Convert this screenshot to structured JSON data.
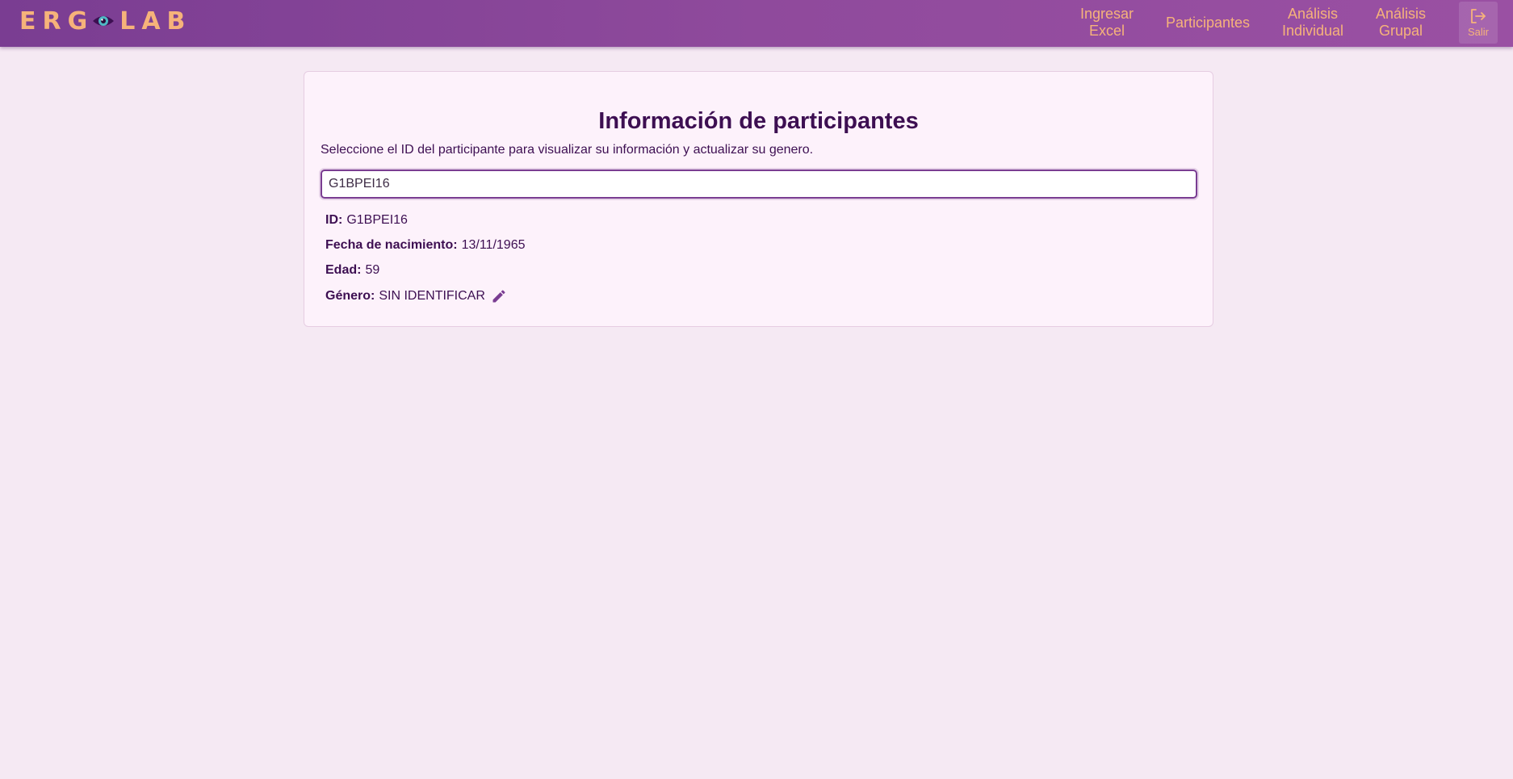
{
  "header": {
    "logo_left": "ERG",
    "logo_right": "LAB",
    "logo_icon": "eye-icon",
    "nav": [
      {
        "line1": "Ingresar",
        "line2": "Excel"
      },
      {
        "line1": "Participantes",
        "line2": ""
      },
      {
        "line1": "Análisis",
        "line2": "Individual"
      },
      {
        "line1": "Análisis",
        "line2": "Grupal"
      }
    ],
    "logout_label": "Salir",
    "logout_icon": "logout-icon"
  },
  "main": {
    "title": "Información de participantes",
    "description": "Seleccione el ID del participante para visualizar su información y actualizar su genero.",
    "search_value": "G1BPEI16",
    "fields": [
      {
        "label": "ID:",
        "value": "G1BPEI16"
      },
      {
        "label": "Fecha de nacimiento:",
        "value": "13/11/1965"
      },
      {
        "label": "Edad:",
        "value": "59"
      },
      {
        "label": "Género:",
        "value": "SIN IDENTIFICAR"
      }
    ],
    "edit_icon": "pencil-icon"
  },
  "colors": {
    "navbar": "#8a4699",
    "accent": "#f6b37a",
    "text": "#3d0f52",
    "background": "#f5e9f3",
    "card": "#fdf2fb"
  }
}
